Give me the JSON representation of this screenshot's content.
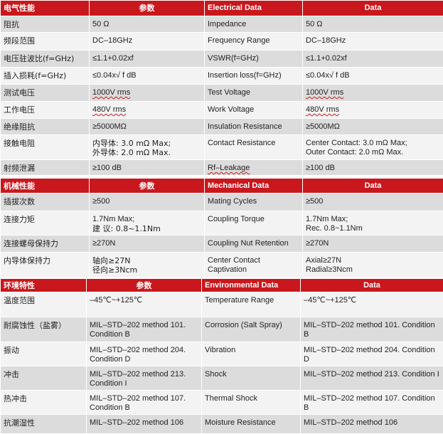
{
  "electrical": {
    "header": [
      "电气性能",
      "参数",
      "Electrical Data",
      "Data"
    ],
    "rows": [
      [
        "阻抗",
        "50 Ω",
        "Impedance",
        "50 Ω"
      ],
      [
        "频段范围",
        "DC–18GHz",
        "Frequency Range",
        "DC–18GHz"
      ],
      [
        "电压驻波比(f=GHz)",
        "≤1.1+0.02xf",
        "VSWR(f=GHz)",
        "≤1.1+0.02xf"
      ],
      [
        "插入损耗(f=GHz)",
        "≤0.04x√ f dB",
        "Insertion loss(f=GHz)",
        "≤0.04x√ f dB"
      ],
      [
        "测试电压",
        "1000V rms",
        "Test Voltage",
        "1000V rms"
      ],
      [
        "工作电压",
        "480V rms",
        "Work Voltage",
        "480V rms"
      ],
      [
        "绝缘阻抗",
        "≥5000MΩ",
        "Insulation Resistance",
        "≥5000MΩ"
      ],
      [
        "接触电阻",
        "内导体: 3.0 mΩ Max;",
        "Contact Resistance",
        "Center Contact: 3.0 mΩ Max;"
      ],
      [
        "射频泄漏",
        "≥100 dB",
        "Rf–Leakage",
        "≥100 dB"
      ]
    ],
    "contact_line2": [
      "外导体: 2.0 mΩ Max.",
      "Outer Contact:  2.0  mΩ Max."
    ]
  },
  "mechanical": {
    "header": [
      "机械性能",
      "参数",
      "Mechanical Data",
      "Data"
    ],
    "rows": [
      [
        "插拔次数",
        "≥500",
        "Mating  Cycles",
        "≥500"
      ],
      [
        "连接力矩",
        "1.7Nm Max;",
        "Coupling Torque",
        "1.7Nm Max;"
      ],
      [
        "连接螺母保持力",
        "≥270N",
        "Coupling Nut Retention",
        "≥270N"
      ],
      [
        "内导体保持力",
        "轴向≥27N",
        "Center Contact Captivation",
        "Axial≥27N"
      ]
    ],
    "torque_line2": [
      "建 议: 0.8~1.1Nm",
      "Rec. 0.8~1.1Nm"
    ],
    "captivation_line2": [
      "径向≥3Ncm",
      "Radial≥3Ncm"
    ]
  },
  "environmental": {
    "header": [
      "环境特性",
      "参数",
      "Environmental Data",
      "Data"
    ],
    "rows": [
      [
        "温度范围",
        "–45℃~+125℃",
        "Temperature Range",
        "–45℃~+125℃"
      ],
      [
        "耐腐蚀性（盐雾）",
        "MIL–STD–202 method 101.",
        "Corrosion (Salt Spray)",
        "MIL–STD–202 method 101. Condition B"
      ],
      [
        "振动",
        "MIL–STD–202 method 204.",
        "Vibration",
        "MIL–STD–202 method 204. Condition D"
      ],
      [
        "冲击",
        "MIL–STD–202 method 213.",
        "Shock",
        "MIL–STD–202 method 213. Condition I"
      ],
      [
        "热冲击",
        "MIL–STD–202 method 107.",
        "Thermal Shock",
        "MIL–STD–202 method 107. Condition B"
      ],
      [
        "抗潮湿性",
        "MIL–STD–202 method 106",
        "Moisture Resistance",
        "MIL–STD–202 method 106"
      ]
    ],
    "param_line2": [
      "Condition B",
      "Condition D",
      "Condition I",
      "Condition B"
    ]
  },
  "colors": {
    "header_bg": "#c8181d",
    "row_dark": "#dcdcdc",
    "row_light": "#f3f3f3"
  }
}
